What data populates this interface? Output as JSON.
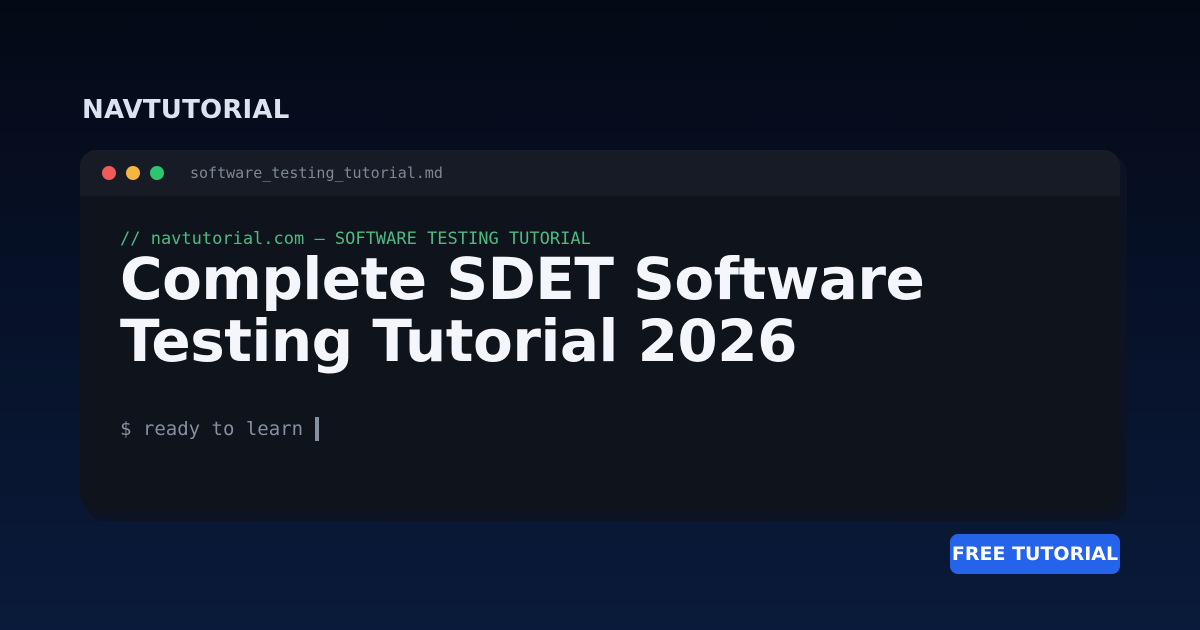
{
  "brand": {
    "name": "NAVTUTORIAL"
  },
  "editor": {
    "filename": "software_testing_tutorial.md",
    "comment": "// navtutorial.com — SOFTWARE TESTING TUTORIAL",
    "title": "Complete SDET Software Testing Tutorial 2026",
    "prompt": "$ ready to learn"
  },
  "badge": {
    "label": "FREE TUTORIAL"
  },
  "colors": {
    "window_dot_close": "#f25a57",
    "window_dot_minimize": "#f4b63f",
    "window_dot_maximize": "#2ec571",
    "comment_text": "#4cbb82",
    "badge_background": "#2563eb"
  },
  "icons": {
    "close_dot": "close-dot-icon",
    "minimize_dot": "minimize-dot-icon",
    "maximize_dot": "maximize-dot-icon",
    "cursor": "text-cursor-icon"
  }
}
